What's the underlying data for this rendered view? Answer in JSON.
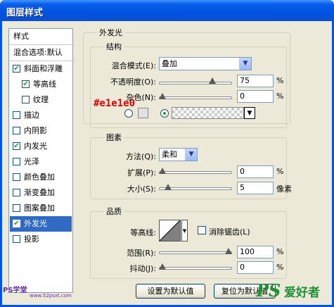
{
  "window": {
    "title": "图层样式"
  },
  "sidebar": {
    "header": "样式",
    "blend_options": "混合选项:默认",
    "items": [
      {
        "label": "斜面和浮雕",
        "checked": true
      },
      {
        "label": "等高线",
        "checked": true
      },
      {
        "label": "纹理",
        "checked": false
      },
      {
        "label": "描边",
        "checked": false
      },
      {
        "label": "内阴影",
        "checked": false
      },
      {
        "label": "内发光",
        "checked": true
      },
      {
        "label": "光泽",
        "checked": false
      },
      {
        "label": "颜色叠加",
        "checked": false
      },
      {
        "label": "渐变叠加",
        "checked": false
      },
      {
        "label": "图案叠加",
        "checked": false
      },
      {
        "label": "外发光",
        "checked": true,
        "selected": true
      },
      {
        "label": "投影",
        "checked": false
      }
    ],
    "check_mark": "✔"
  },
  "panel": {
    "title": "外发光",
    "structure": {
      "title": "结构",
      "blend_mode_label": "混合模式(E):",
      "blend_mode_value": "叠加",
      "opacity_label": "不透明度(O):",
      "opacity_value": "75",
      "opacity_level": 0.75,
      "noise_label": "杂色(N):",
      "noise_value": "0",
      "noise_level": 0,
      "percent": "%",
      "color_annotation": "#e1e1e0",
      "swatch_color": "#e1e1e0"
    },
    "elements": {
      "title": "图素",
      "method_label": "方法(Q):",
      "method_value": "柔和",
      "spread_label": "扩展(P):",
      "spread_value": "0",
      "spread_level": 0,
      "size_label": "大小(S):",
      "size_value": "5",
      "size_unit": "像素",
      "percent": "%"
    },
    "quality": {
      "title": "品质",
      "contour_label": "等高线:",
      "antialias_label": "消除锯齿(L)",
      "range_label": "范围(R):",
      "range_value": "100",
      "range_level": 1.0,
      "jitter_label": "抖动(J):",
      "jitter_value": "0",
      "jitter_level": 0,
      "percent": "%"
    },
    "buttons": {
      "make_default": "设置为默认值",
      "reset_default": "复位为默认值"
    }
  },
  "watermarks": {
    "left": "PS学堂",
    "left_url": "www.52psxt.com",
    "right_logo": "PS",
    "right_text": "爱好者"
  },
  "colors": {
    "accent": "#316ac5",
    "annotation": "#e00000",
    "titlebar": "#0054e3"
  }
}
